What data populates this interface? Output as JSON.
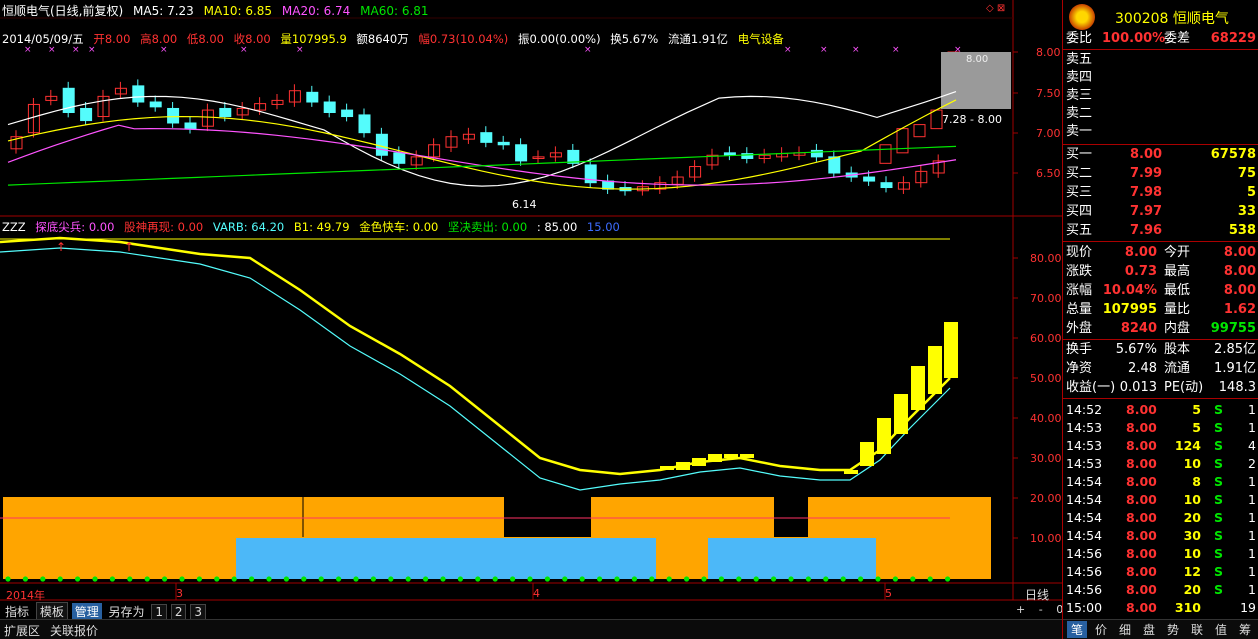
{
  "header1": {
    "title": "恒顺电气(日线,前复权)",
    "ma5": "MA5: 7.23",
    "ma10": "MA10: 6.85",
    "ma20": "MA20: 6.74",
    "ma60": "MA60: 6.81"
  },
  "header2": {
    "date": "2014/05/09/五",
    "open": "开8.00",
    "high": "高8.00",
    "low": "低8.00",
    "close": "收8.00",
    "volume": "量107995.9",
    "amount": "额8640万",
    "change": "幅0.73(10.04%)",
    "amplitude": "振0.00(0.00%)",
    "turnover": "换5.67%",
    "float": "流通1.91亿",
    "sector": "电气设备"
  },
  "indicator_header": {
    "name": "ZZZ",
    "tandi": "探底尖兵: 0.00",
    "guzhen": "股神再现: 0.00",
    "varb": "VARB: 64.20",
    "b1": "B1: 49.79",
    "jinse": "金色快车: 0.00",
    "jianjue": "坚决卖出: 0.00",
    "v85": ": 85.00",
    "v15": "15.00"
  },
  "price_axis": [
    "8.00",
    "7.50",
    "7.00",
    "6.50"
  ],
  "ind_axis": [
    "80.00",
    "70.00",
    "60.00",
    "50.00",
    "40.00",
    "30.00",
    "20.00",
    "10.00"
  ],
  "annotations": {
    "high_label": "8.00",
    "range_label": "7.28 - 8.00",
    "low_label": "6.14"
  },
  "time_axis": {
    "year": "2014年",
    "m3": "3",
    "m4": "4",
    "m5": "5",
    "period": "日线"
  },
  "bottom_bar": {
    "tabs": [
      "指标",
      "模板",
      "管理",
      "另存为",
      "1",
      "2",
      "3"
    ],
    "row2": [
      "扩展区",
      "关联报价"
    ],
    "zoom": [
      "+",
      "-",
      "0"
    ]
  },
  "right_panel": {
    "code": "300208",
    "name": "恒顺电气",
    "weibi_label": "委比",
    "weibi_value": "100.00%",
    "weicha_label": "委差",
    "weicha_value": "68229",
    "sell": [
      {
        "label": "卖五",
        "price": "",
        "vol": ""
      },
      {
        "label": "卖四",
        "price": "",
        "vol": ""
      },
      {
        "label": "卖三",
        "price": "",
        "vol": ""
      },
      {
        "label": "卖二",
        "price": "",
        "vol": ""
      },
      {
        "label": "卖一",
        "price": "",
        "vol": ""
      }
    ],
    "buy": [
      {
        "label": "买一",
        "price": "8.00",
        "vol": "67578"
      },
      {
        "label": "买二",
        "price": "7.99",
        "vol": "75"
      },
      {
        "label": "买三",
        "price": "7.98",
        "vol": "5"
      },
      {
        "label": "买四",
        "price": "7.97",
        "vol": "33"
      },
      {
        "label": "买五",
        "price": "7.96",
        "vol": "538"
      }
    ],
    "quote": [
      {
        "l1": "现价",
        "v1": "8.00",
        "l2": "今开",
        "v2": "8.00"
      },
      {
        "l1": "涨跌",
        "v1": "0.73",
        "l2": "最高",
        "v2": "8.00"
      },
      {
        "l1": "涨幅",
        "v1": "10.04%",
        "l2": "最低",
        "v2": "8.00"
      },
      {
        "l1": "总量",
        "v1": "107995",
        "l2": "量比",
        "v2": "1.62"
      },
      {
        "l1": "外盘",
        "v1": "8240",
        "l2": "内盘",
        "v2": "99755"
      }
    ],
    "fund": [
      {
        "l1": "换手",
        "v1": "5.67%",
        "l2": "股本",
        "v2": "2.85亿"
      },
      {
        "l1": "净资",
        "v1": "2.48",
        "l2": "流通",
        "v2": "1.91亿"
      },
      {
        "l1": "收益(一)",
        "v1": "0.013",
        "l2": "PE(动)",
        "v2": "148.3"
      }
    ],
    "ticks": [
      {
        "t": "14:52",
        "p": "8.00",
        "v": "5",
        "s": "S",
        "n": "1"
      },
      {
        "t": "14:53",
        "p": "8.00",
        "v": "5",
        "s": "S",
        "n": "1"
      },
      {
        "t": "14:53",
        "p": "8.00",
        "v": "124",
        "s": "S",
        "n": "4"
      },
      {
        "t": "14:53",
        "p": "8.00",
        "v": "10",
        "s": "S",
        "n": "2"
      },
      {
        "t": "14:54",
        "p": "8.00",
        "v": "8",
        "s": "S",
        "n": "1"
      },
      {
        "t": "14:54",
        "p": "8.00",
        "v": "10",
        "s": "S",
        "n": "1"
      },
      {
        "t": "14:54",
        "p": "8.00",
        "v": "20",
        "s": "S",
        "n": "1"
      },
      {
        "t": "14:54",
        "p": "8.00",
        "v": "30",
        "s": "S",
        "n": "1"
      },
      {
        "t": "14:56",
        "p": "8.00",
        "v": "10",
        "s": "S",
        "n": "1"
      },
      {
        "t": "14:56",
        "p": "8.00",
        "v": "12",
        "s": "S",
        "n": "1"
      },
      {
        "t": "14:56",
        "p": "8.00",
        "v": "20",
        "s": "S",
        "n": "1"
      },
      {
        "t": "15:00",
        "p": "8.00",
        "v": "310",
        "s": "",
        "n": "19"
      }
    ],
    "bottom_tabs": [
      "笔",
      "价",
      "细",
      "盘",
      "势",
      "联",
      "值",
      "筹"
    ]
  },
  "colors": {
    "up": "#ff3232",
    "down": "#54fcfc",
    "grid": "#a00000",
    "yellow": "#ffff00",
    "orange": "#ffa500",
    "lightblue": "#4cb8f8"
  }
}
